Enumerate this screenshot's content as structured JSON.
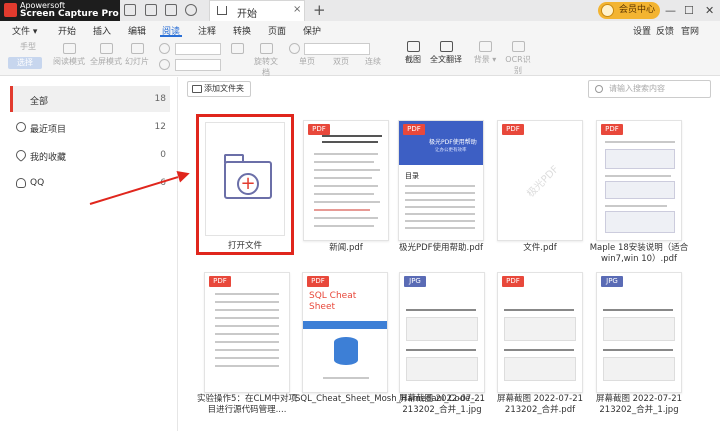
{
  "app": {
    "brand_line1": "Apowersoft",
    "brand_line2": "Screen Capture Pro"
  },
  "tab": {
    "label": "开始",
    "close": "×",
    "new": "+"
  },
  "vip": {
    "label": "会员中心"
  },
  "window": {
    "minimize": "—",
    "maximize": "☐",
    "close": "✕"
  },
  "menu": {
    "file": "文件 ▾",
    "items": [
      "开始",
      "插入",
      "编辑",
      "阅读",
      "注释",
      "转换",
      "页面",
      "保护"
    ],
    "active": "阅读",
    "right": [
      "设置",
      "反馈",
      "官网"
    ]
  },
  "toolbar": {
    "hand": "手型",
    "select": "选择",
    "read_mode": "阅读模式",
    "fullscreen": "全屏模式",
    "slideshow": "幻灯片",
    "rotate": "旋转文档",
    "single": "单页",
    "double": "双页",
    "continuous": "连续",
    "screenshot": "截图",
    "translate": "全文翻译",
    "background": "背景 ▾",
    "ocr": "OCR识别"
  },
  "sidebar": {
    "items": [
      {
        "label": "全部",
        "count": "18"
      },
      {
        "label": "最近项目",
        "count": "12"
      },
      {
        "label": "我的收藏",
        "count": "0"
      },
      {
        "label": "QQ",
        "count": "6"
      }
    ]
  },
  "content": {
    "add_folder": "添加文件夹",
    "search_placeholder": "请输入搜索内容",
    "open_file": "打开文件",
    "files": [
      {
        "name": "新闻.pdf",
        "type": "PDF"
      },
      {
        "name": "极光PDF使用帮助.pdf",
        "type": "PDF",
        "cover_title": "极光PDF使用帮助",
        "cover_sub": "让办公更有效率",
        "toc": "目录"
      },
      {
        "name": "文件.pdf",
        "type": "PDF",
        "watermark": "极光PDF"
      },
      {
        "name": "Maple 18安装说明（适合win7,win 10）.pdf",
        "type": "PDF"
      },
      {
        "name": "实验操作5：在CLM中对项目进行源代码管理....",
        "type": "PDF"
      },
      {
        "name": "SQL_Cheat_Sheet_Mosh_Hamedani_Code_...",
        "type": "PDF",
        "cover_title": "SQL Cheat Sheet"
      },
      {
        "name": "屏幕截图 2022-07-21 213202_合并_1.jpg",
        "type": "JPG"
      },
      {
        "name": "屏幕截图 2022-07-21 213202_合并.pdf",
        "type": "PDF"
      },
      {
        "name": "屏幕截图 2022-07-21 213202_合并_1.jpg",
        "type": "JPG"
      }
    ]
  },
  "colors": {
    "accent": "#2a6fd6",
    "brand_red": "#e23b2e",
    "highlight": "#e0261d",
    "vip": "#f3b431"
  }
}
